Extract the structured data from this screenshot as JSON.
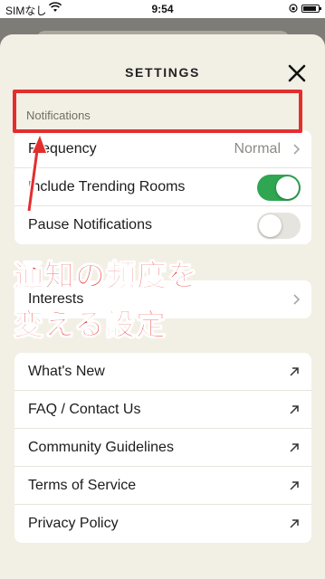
{
  "status_bar": {
    "carrier": "SIMなし",
    "time": "9:54"
  },
  "sheet": {
    "title": "SETTINGS"
  },
  "notifications": {
    "section_label": "Notifications",
    "frequency": {
      "label": "Frequency",
      "value": "Normal"
    },
    "include_trending": {
      "label": "Include Trending Rooms",
      "enabled": true
    },
    "pause": {
      "label": "Pause Notifications",
      "enabled": false
    }
  },
  "interests": {
    "label": "Interests"
  },
  "links": [
    {
      "label": "What's New"
    },
    {
      "label": "FAQ / Contact Us"
    },
    {
      "label": "Community Guidelines"
    },
    {
      "label": "Terms of Service"
    },
    {
      "label": "Privacy Policy"
    }
  ],
  "annotation": {
    "line1": "通知の頻度を",
    "line2": "変える設定",
    "color": "#e32e2e"
  },
  "colors": {
    "toggle_on": "#2fa652",
    "sheet_bg": "#f2efe4"
  }
}
